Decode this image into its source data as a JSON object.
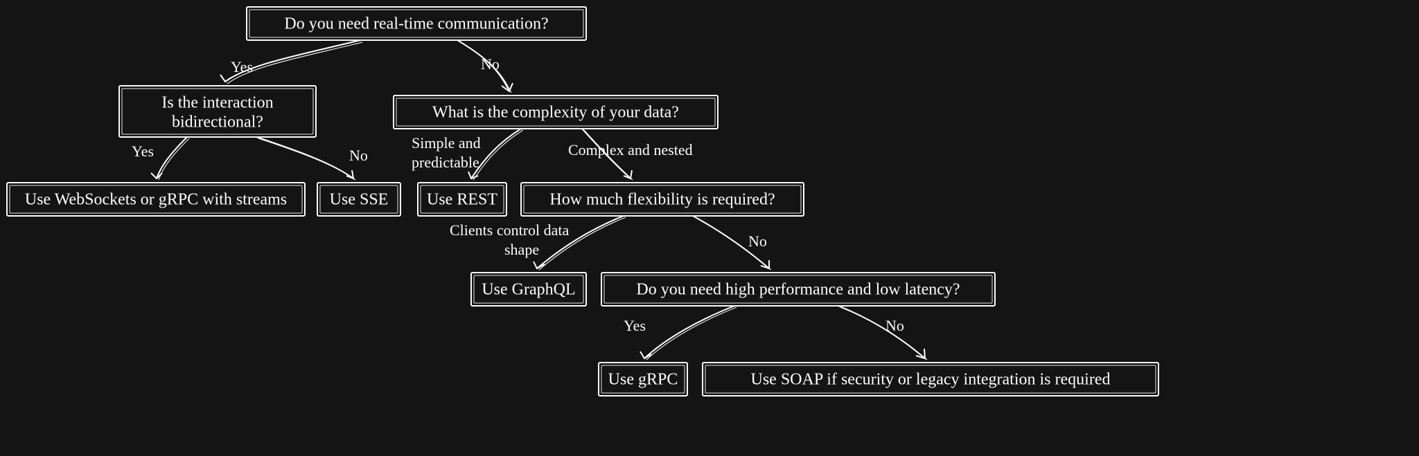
{
  "chart_data": {
    "type": "decision-tree",
    "title": "",
    "nodes": {
      "root": {
        "label": "Do you need real-time communication?"
      },
      "bidi": {
        "label_line1": "Is the interaction",
        "label_line2": "bidirectional?"
      },
      "complexity": {
        "label": "What is the complexity of your data?"
      },
      "ws": {
        "label": "Use WebSockets or gRPC with streams"
      },
      "sse": {
        "label": "Use SSE"
      },
      "rest": {
        "label": "Use REST"
      },
      "flex": {
        "label": "How much flexibility is required?"
      },
      "graphql": {
        "label": "Use GraphQL"
      },
      "perf": {
        "label": "Do you need high performance and low latency?"
      },
      "grpc": {
        "label": "Use gRPC"
      },
      "soap": {
        "label": "Use SOAP if security or legacy integration is required"
      }
    },
    "edges": {
      "root_yes": {
        "label": "Yes",
        "from": "root",
        "to": "bidi"
      },
      "root_no": {
        "label": "No",
        "from": "root",
        "to": "complexity"
      },
      "bidi_yes": {
        "label": "Yes",
        "from": "bidi",
        "to": "ws"
      },
      "bidi_no": {
        "label": "No",
        "from": "bidi",
        "to": "sse"
      },
      "complexity_simple": {
        "label_line1": "Simple and",
        "label_line2": "predictable",
        "from": "complexity",
        "to": "rest"
      },
      "complexity_nested": {
        "label": "Complex and nested",
        "from": "complexity",
        "to": "flex"
      },
      "flex_clients": {
        "label_line1": "Clients control data",
        "label_line2": "shape",
        "from": "flex",
        "to": "graphql"
      },
      "flex_no": {
        "label": "No",
        "from": "flex",
        "to": "perf"
      },
      "perf_yes": {
        "label": "Yes",
        "from": "perf",
        "to": "grpc"
      },
      "perf_no": {
        "label": "No",
        "from": "perf",
        "to": "soap"
      }
    }
  }
}
